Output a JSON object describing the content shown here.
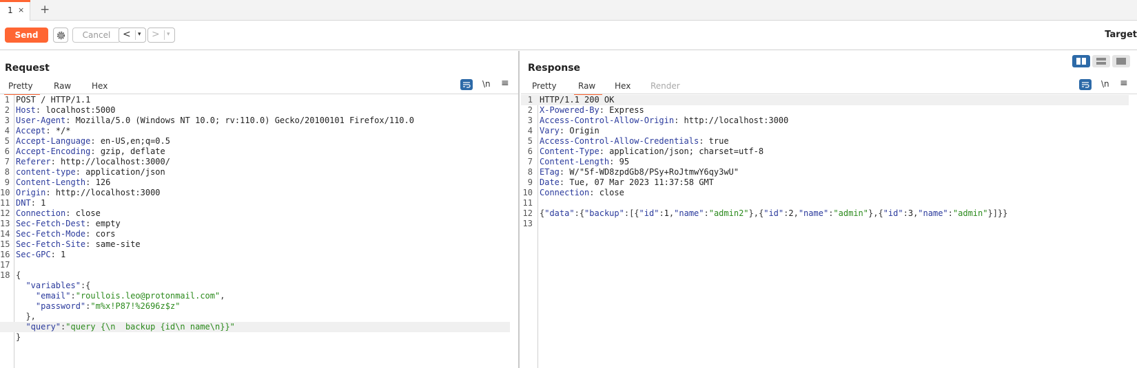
{
  "tabs": [
    {
      "label": "1",
      "close": "×"
    }
  ],
  "tab_add": "+",
  "toolbar": {
    "send": "Send",
    "cancel": "Cancel",
    "back": "<",
    "forward": ">",
    "dropdown": "▾",
    "target": "Target"
  },
  "request": {
    "title": "Request",
    "subtabs": [
      "Pretty",
      "Raw",
      "Hex"
    ],
    "active_subtab": "Pretty",
    "newline_icon": "\\n",
    "menu_icon": "≡",
    "headers": [
      {
        "n": "1",
        "text": "POST / HTTP/1.1"
      },
      {
        "n": "2",
        "key": "Host",
        "val": " localhost:5000"
      },
      {
        "n": "3",
        "key": "User-Agent",
        "val": " Mozilla/5.0 (Windows NT 10.0; rv:110.0) Gecko/20100101 Firefox/110.0"
      },
      {
        "n": "4",
        "key": "Accept",
        "val": " */*"
      },
      {
        "n": "5",
        "key": "Accept-Language",
        "val": " en-US,en;q=0.5"
      },
      {
        "n": "6",
        "key": "Accept-Encoding",
        "val": " gzip, deflate"
      },
      {
        "n": "7",
        "key": "Referer",
        "val": " http://localhost:3000/"
      },
      {
        "n": "8",
        "key": "content-type",
        "val": " application/json"
      },
      {
        "n": "9",
        "key": "Content-Length",
        "val": " 126"
      },
      {
        "n": "10",
        "key": "Origin",
        "val": " http://localhost:3000"
      },
      {
        "n": "11",
        "key": "DNT",
        "val": " 1"
      },
      {
        "n": "12",
        "key": "Connection",
        "val": " close"
      },
      {
        "n": "13",
        "key": "Sec-Fetch-Dest",
        "val": " empty"
      },
      {
        "n": "14",
        "key": "Sec-Fetch-Mode",
        "val": " cors"
      },
      {
        "n": "15",
        "key": "Sec-Fetch-Site",
        "val": " same-site"
      },
      {
        "n": "16",
        "key": "Sec-GPC",
        "val": " 1"
      },
      {
        "n": "17",
        "text": ""
      },
      {
        "n": "18",
        "text": "{"
      }
    ],
    "body": {
      "variables_key": "\"variables\"",
      "email_key": "\"email\"",
      "email_val": "\"roullois.leo@protonmail.com\"",
      "password_key": "\"password\"",
      "password_val": "\"m%x!P87!%2696z$z\"",
      "query_key": "\"query\"",
      "query_val": "\"query {\\n  backup {id\\n name\\n}}\""
    }
  },
  "response": {
    "title": "Response",
    "subtabs": [
      "Pretty",
      "Raw",
      "Hex",
      "Render"
    ],
    "active_subtab": "Raw",
    "newline_icon": "\\n",
    "menu_icon": "≡",
    "lines": [
      {
        "n": "1",
        "text": "HTTP/1.1 200 OK"
      },
      {
        "n": "2",
        "key": "X-Powered-By",
        "val": " Express"
      },
      {
        "n": "3",
        "key": "Access-Control-Allow-Origin",
        "val": " http://localhost:3000"
      },
      {
        "n": "4",
        "key": "Vary",
        "val": " Origin"
      },
      {
        "n": "5",
        "key": "Access-Control-Allow-Credentials",
        "val": " true"
      },
      {
        "n": "6",
        "key": "Content-Type",
        "val": " application/json; charset=utf-8"
      },
      {
        "n": "7",
        "key": "Content-Length",
        "val": " 95"
      },
      {
        "n": "8",
        "key": "ETag",
        "val": " W/\"5f-WD8zpdGb8/PSy+RoJtmwY6qy3wU\""
      },
      {
        "n": "9",
        "key": "Date",
        "val": " Tue, 07 Mar 2023 11:37:58 GMT"
      },
      {
        "n": "10",
        "key": "Connection",
        "val": " close"
      },
      {
        "n": "11",
        "text": ""
      },
      {
        "n": "12",
        "text": ""
      },
      {
        "n": "13",
        "text": ""
      }
    ],
    "json_line": {
      "data_key": "\"data\"",
      "backup_key": "\"backup\"",
      "items": [
        {
          "id_key": "\"id\"",
          "id": "1",
          "name_key": "\"name\"",
          "name": "\"admin2\""
        },
        {
          "id_key": "\"id\"",
          "id": "2",
          "name_key": "\"name\"",
          "name": "\"admin\""
        },
        {
          "id_key": "\"id\"",
          "id": "3",
          "name_key": "\"name\"",
          "name": "\"admin\""
        }
      ]
    }
  },
  "colors": {
    "accent": "#ff6633",
    "header_key": "#2a3a9c",
    "string": "#2b8a1c",
    "icon_active": "#2d6aa8"
  }
}
